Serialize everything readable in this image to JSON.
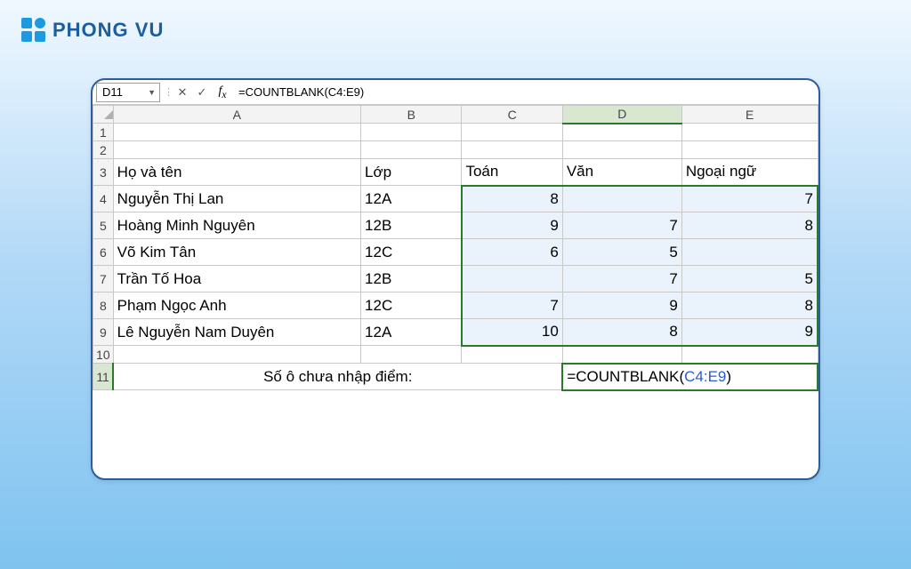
{
  "brand": {
    "name": "PHONG VU"
  },
  "formula_bar": {
    "cell_ref": "D11",
    "formula": "=COUNTBLANK(C4:E9)"
  },
  "columns": [
    "A",
    "B",
    "C",
    "D",
    "E"
  ],
  "headers": {
    "name": "Họ và tên",
    "class": "Lớp",
    "math": "Toán",
    "lit": "Văn",
    "lang": "Ngoại ngữ"
  },
  "rows": [
    {
      "name": "Nguyễn Thị Lan",
      "class": "12A",
      "math": "8",
      "lit": "",
      "lang": "7"
    },
    {
      "name": "Hoàng Minh Nguyên",
      "class": "12B",
      "math": "9",
      "lit": "7",
      "lang": "8"
    },
    {
      "name": "Võ Kim Tân",
      "class": "12C",
      "math": "6",
      "lit": "5",
      "lang": ""
    },
    {
      "name": "Trần Tố Hoa",
      "class": "12B",
      "math": "",
      "lit": "7",
      "lang": "5"
    },
    {
      "name": "Phạm Ngọc Anh",
      "class": "12C",
      "math": "7",
      "lit": "9",
      "lang": "8"
    },
    {
      "name": "Lê Nguyễn Nam Duyên",
      "class": "12A",
      "math": "10",
      "lit": "8",
      "lang": "9"
    }
  ],
  "summary": {
    "label": "Số ô chưa nhập điểm:",
    "formula_prefix": "=COUNTBLANK(",
    "formula_ref": "C4:E9",
    "formula_suffix": ")"
  },
  "row_numbers": [
    "1",
    "2",
    "3",
    "4",
    "5",
    "6",
    "7",
    "8",
    "9",
    "10",
    "11"
  ],
  "chart_data": {
    "type": "table",
    "title": "Student grades with COUNTBLANK demo",
    "columns": [
      "Họ và tên",
      "Lớp",
      "Toán",
      "Văn",
      "Ngoại ngữ"
    ],
    "records": [
      [
        "Nguyễn Thị Lan",
        "12A",
        8,
        null,
        7
      ],
      [
        "Hoàng Minh Nguyên",
        "12B",
        9,
        7,
        8
      ],
      [
        "Võ Kim Tân",
        "12C",
        6,
        5,
        null
      ],
      [
        "Trần Tố Hoa",
        "12B",
        null,
        7,
        5
      ],
      [
        "Phạm Ngọc Anh",
        "12C",
        7,
        9,
        8
      ],
      [
        "Lê Nguyễn Nam Duyên",
        "12A",
        10,
        8,
        9
      ]
    ],
    "formula": "=COUNTBLANK(C4:E9)",
    "selected_range": "C4:E9",
    "active_cell": "D11"
  }
}
